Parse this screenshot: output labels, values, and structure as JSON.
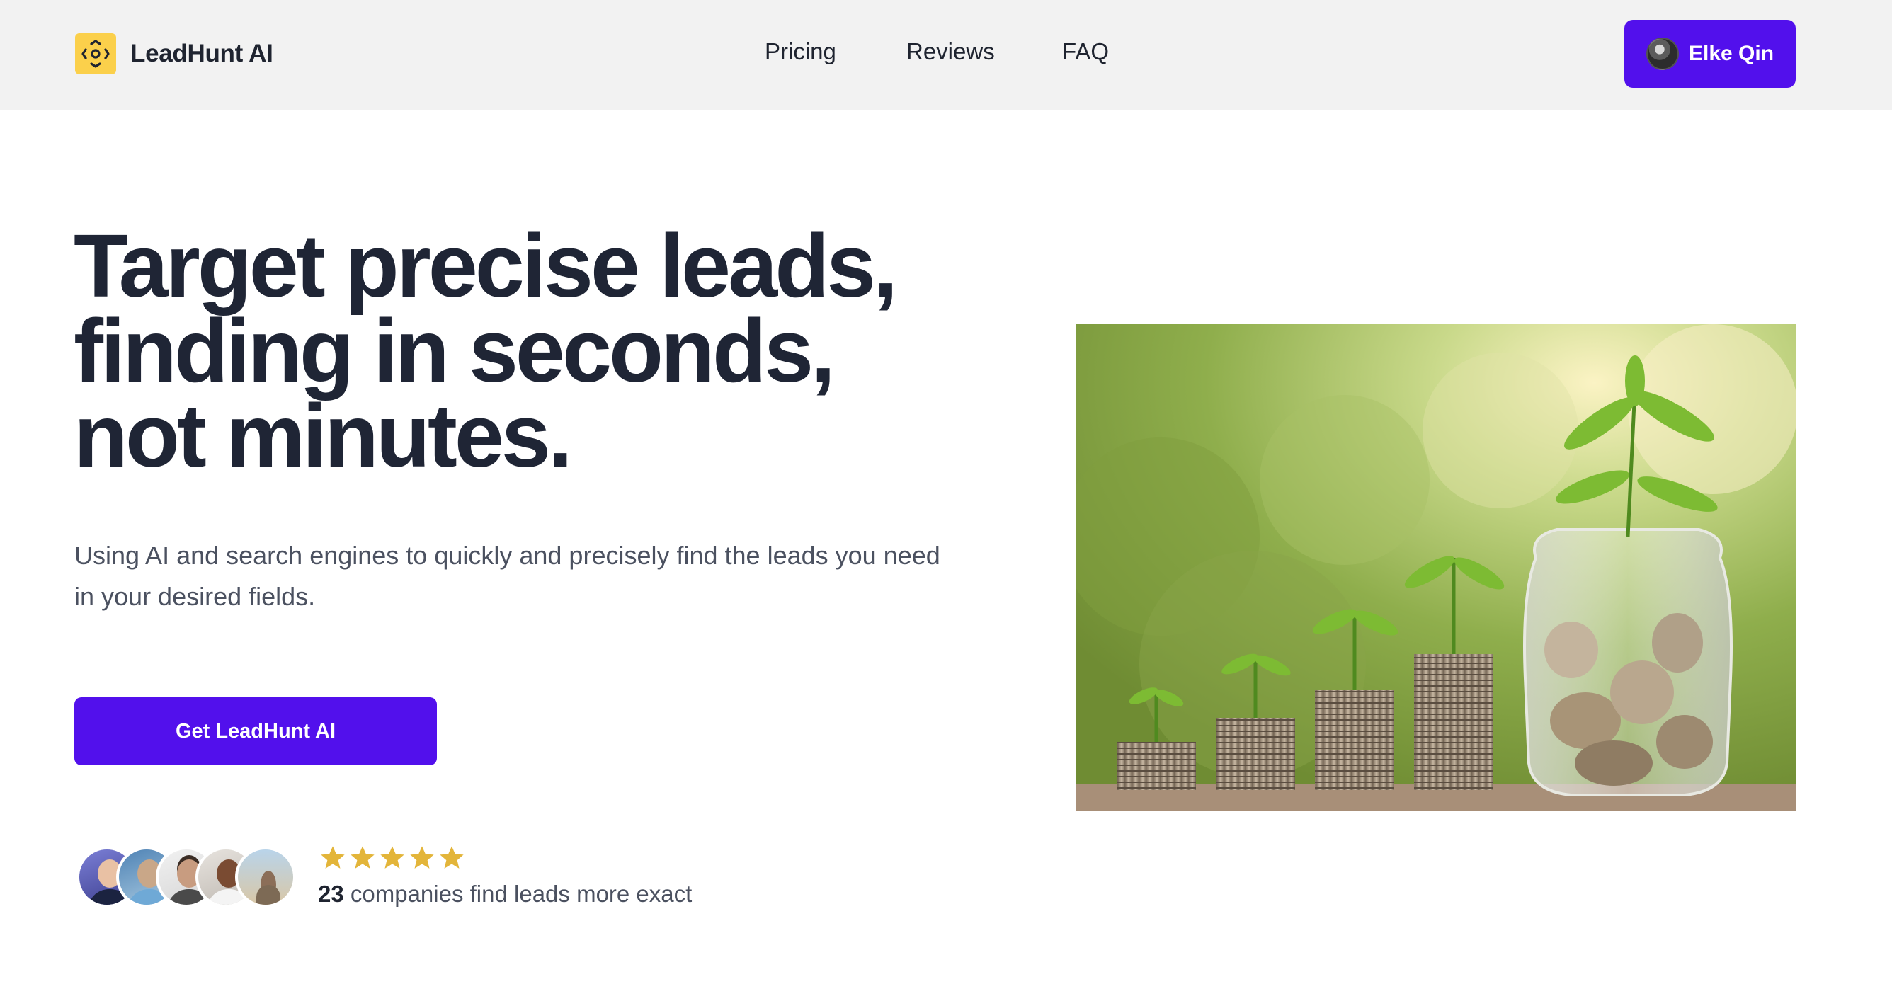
{
  "brand": {
    "name": "LeadHunt AI",
    "icon": "focus-target-icon",
    "icon_color": "#fbd04b"
  },
  "nav": {
    "items": [
      {
        "label": "Pricing"
      },
      {
        "label": "Reviews"
      },
      {
        "label": "FAQ"
      }
    ]
  },
  "user": {
    "name": "Elke Qin",
    "avatar": "user-avatar-photo"
  },
  "hero": {
    "headline_lines": [
      "Target precise leads,",
      "finding in seconds,",
      "not minutes."
    ],
    "subtext": "Using AI and search engines to quickly and precisely find the leads you need in your desired fields.",
    "cta_label": "Get LeadHunt AI",
    "image": "coin-stacks-with-growing-plants-photo"
  },
  "social_proof": {
    "avatar_count": 5,
    "rating": 5,
    "rating_max": 5,
    "count": "23",
    "text": " companies find leads more exact"
  },
  "colors": {
    "accent": "#5210ec",
    "header_bg": "#f2f2f2",
    "headline": "#1f2535",
    "star": "#e3b53a"
  }
}
